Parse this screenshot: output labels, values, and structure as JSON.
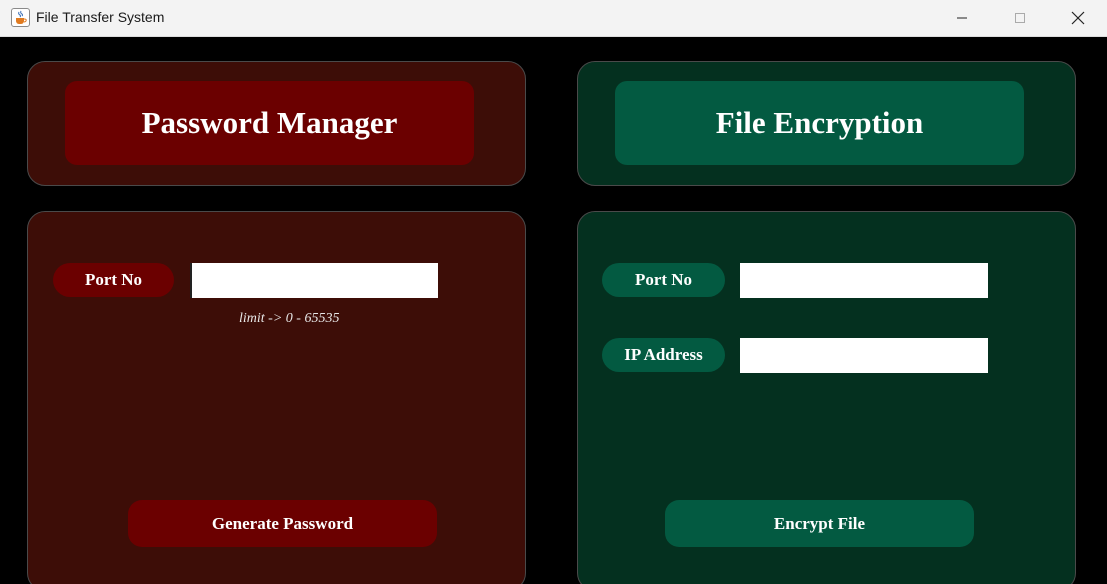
{
  "window": {
    "title": "File Transfer System",
    "icon": "java-cup-icon",
    "controls": [
      "minimize-icon",
      "maximize-icon",
      "close-icon"
    ]
  },
  "colors": {
    "background": "#000000",
    "red_panel": "#3d0d07",
    "red_accent": "#6b0000",
    "green_panel": "#04301f",
    "green_accent": "#035a41"
  },
  "password_manager": {
    "title": "Password Manager",
    "port_label": "Port No",
    "port_value": "",
    "hint": "limit -> 0 - 65535",
    "button_label": "Generate Password"
  },
  "file_encryption": {
    "title": "File Encryption",
    "port_label": "Port No",
    "port_value": "",
    "ip_label": "IP Address",
    "ip_value": "",
    "button_label": "Encrypt File"
  }
}
